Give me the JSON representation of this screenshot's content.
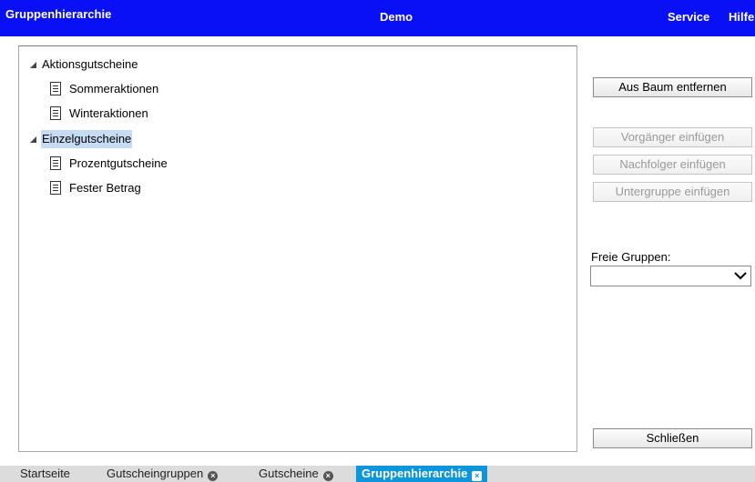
{
  "header": {
    "title": "Gruppenhierarchie",
    "center": "Demo",
    "service": "Service",
    "help": "Hilfe"
  },
  "tree": {
    "groups": [
      {
        "label": "Aktionsgutscheine",
        "expanded": true,
        "selected": false,
        "children": [
          {
            "label": "Sommeraktionen"
          },
          {
            "label": "Winteraktionen"
          }
        ]
      },
      {
        "label": "Einzelgutscheine",
        "expanded": true,
        "selected": true,
        "children": [
          {
            "label": "Prozentgutscheine"
          },
          {
            "label": "Fester Betrag"
          }
        ]
      }
    ]
  },
  "actions": {
    "remove": "Aus Baum entfernen",
    "predecessor": "Vorgänger einfügen",
    "successor": "Nachfolger einfügen",
    "subgroup": "Untergruppe einfügen",
    "close": "Schließen"
  },
  "free_groups": {
    "label": "Freie Gruppen:",
    "value": ""
  },
  "tabs": [
    {
      "label": "Startseite",
      "closable": false,
      "active": false
    },
    {
      "label": "Gutscheingruppen",
      "closable": true,
      "active": false
    },
    {
      "label": "Gutscheine",
      "closable": true,
      "active": false
    },
    {
      "label": "Gruppenhierarchie",
      "closable": true,
      "active": true
    }
  ],
  "colors": {
    "header_bg": "#0a10f5",
    "active_tab": "#0e96dc",
    "selection": "#c6dcf5"
  }
}
